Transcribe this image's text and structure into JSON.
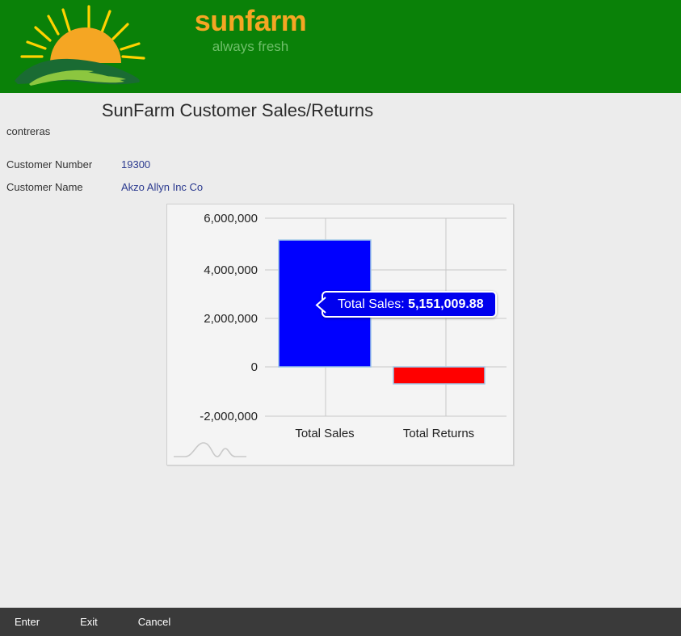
{
  "header": {
    "brand_name": "sunfarm",
    "brand_tagline": "always fresh",
    "brand_color": "#f5a623",
    "banner_color": "#0a8108",
    "tagline_color": "#6fbf6a",
    "logo_icon": "sunrise-over-field-icon"
  },
  "page": {
    "title": "SunFarm Customer Sales/Returns",
    "user": "contreras"
  },
  "fields": [
    {
      "label": "Customer Number",
      "value": "19300"
    },
    {
      "label": "Customer Name",
      "value": "Akzo Allyn Inc Co"
    }
  ],
  "tooltip": {
    "label": "Total Sales:",
    "value": "5,151,009.88",
    "background": "#0000ee",
    "text_color": "#ffffff"
  },
  "chart_data": {
    "type": "bar",
    "title": "",
    "xlabel": "",
    "ylabel": "",
    "categories": [
      "Total Sales",
      "Total Returns"
    ],
    "values": [
      5151009.88,
      -694000
    ],
    "series": [
      {
        "name": "Total Sales",
        "values": [
          5151009.88
        ],
        "color": "#0000ff"
      },
      {
        "name": "Total Returns",
        "values": [
          -694000
        ],
        "color": "#ff0000"
      }
    ],
    "ylim": [
      -2000000,
      6000000
    ],
    "yticks": [
      6000000,
      4000000,
      2000000,
      0,
      -2000000
    ],
    "ytick_labels": [
      "6,000,000",
      "4,000,000",
      "2,000,000",
      "0",
      "-2,000,000"
    ],
    "grid": true,
    "legend": "none",
    "watermark_icon": "chart-watermark-icon"
  },
  "actions": [
    {
      "label": "Enter"
    },
    {
      "label": "Exit"
    },
    {
      "label": "Cancel"
    }
  ]
}
